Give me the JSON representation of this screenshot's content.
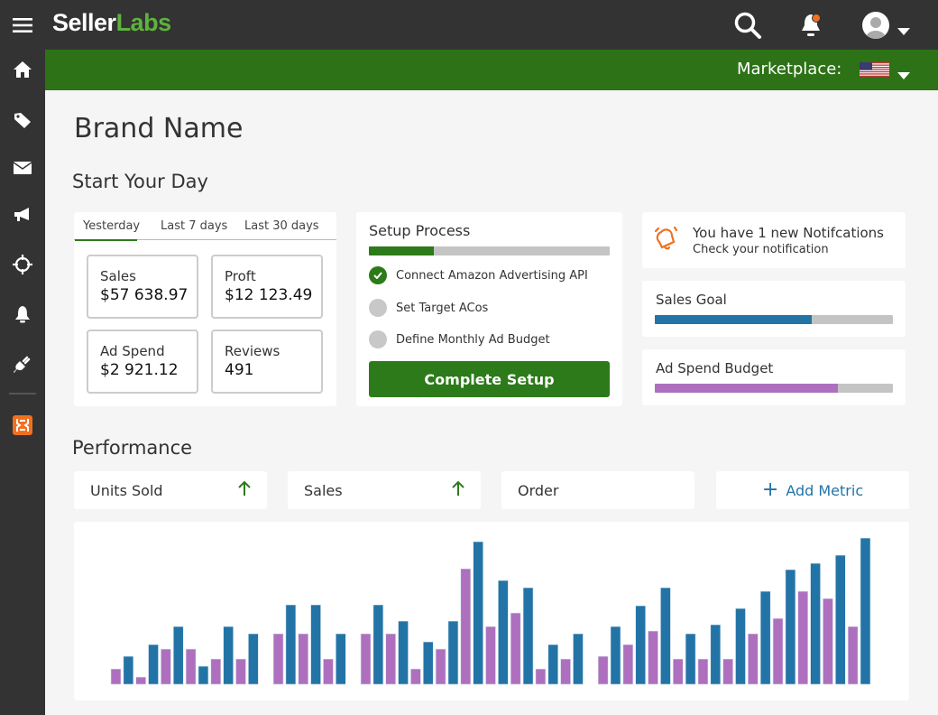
{
  "app": {
    "logo_main": "Seller",
    "logo_accent": "Labs"
  },
  "header": {
    "marketplace_label": "Marketplace:",
    "marketplace_flag": "us-flag-icon",
    "notification_dot_color": "#f07020"
  },
  "sidebar": {
    "items": [
      "menu-icon",
      "home-icon",
      "tag-icon",
      "mail-icon",
      "megaphone-icon",
      "crosshair-icon",
      "bell-icon",
      "plug-icon",
      "app-icon"
    ]
  },
  "page": {
    "title": "Brand Name",
    "start_title": "Start Your Day",
    "performance_title": "Performance"
  },
  "stats": {
    "tabs": [
      {
        "label": "Yesterday",
        "active": true
      },
      {
        "label": "Last 7 days"
      },
      {
        "label": "Last 30 days"
      }
    ],
    "cards": [
      {
        "label": "Sales",
        "value": "$57 638.97"
      },
      {
        "label": "Proft",
        "value": "$12 123.49"
      },
      {
        "label": "Ad Spend",
        "value": "$2 921.12"
      },
      {
        "label": "Reviews",
        "value": "491"
      }
    ]
  },
  "setup": {
    "title": "Setup Process",
    "progress_percent": 27,
    "steps": [
      {
        "label": "Connect Amazon Advertising API",
        "done": true
      },
      {
        "label": "Set Target ACos",
        "done": false
      },
      {
        "label": "Define Monthly Ad Budget",
        "done": false
      }
    ],
    "button": "Complete Setup"
  },
  "notification": {
    "title": "You have 1 new Notifcations",
    "subtitle": "Check your notification"
  },
  "goals": [
    {
      "label": "Sales Goal",
      "percent": 66,
      "color": "#2374a6"
    },
    {
      "label": "Ad Spend Budget",
      "percent": 77,
      "color": "#ae70be"
    }
  ],
  "metrics": [
    {
      "label": "Units Sold",
      "trend": "up"
    },
    {
      "label": "Sales",
      "trend": "up"
    },
    {
      "label": "Order"
    }
  ],
  "add_metric": "Add Metric",
  "colors": {
    "brand_green": "#2d7216",
    "blue": "#2374a6",
    "purple": "#ae70be"
  },
  "chart_data": {
    "type": "bar",
    "colors": [
      "#ae70be",
      "#2374a6"
    ],
    "groups": [
      [
        [
          17,
          31
        ],
        [
          8,
          44
        ],
        [
          39,
          64
        ],
        [
          39,
          20
        ],
        [
          28,
          64
        ],
        [
          28,
          56
        ]
      ],
      [
        [
          56,
          88
        ],
        [
          56,
          88
        ],
        [
          28,
          56
        ]
      ],
      [
        [
          56,
          88
        ],
        [
          56,
          70
        ],
        [
          17,
          47
        ],
        [
          39,
          70
        ],
        [
          128,
          158
        ],
        [
          64,
          115
        ],
        [
          79,
          107
        ],
        [
          17,
          44
        ],
        [
          28,
          56
        ]
      ],
      [
        [
          31,
          64
        ],
        [
          44,
          87
        ],
        [
          59,
          107
        ],
        [
          28,
          56
        ],
        [
          28,
          66
        ],
        [
          28,
          84
        ],
        [
          56,
          103
        ],
        [
          73,
          127
        ],
        [
          103,
          134
        ],
        [
          95,
          143
        ],
        [
          64,
          162
        ]
      ]
    ]
  }
}
